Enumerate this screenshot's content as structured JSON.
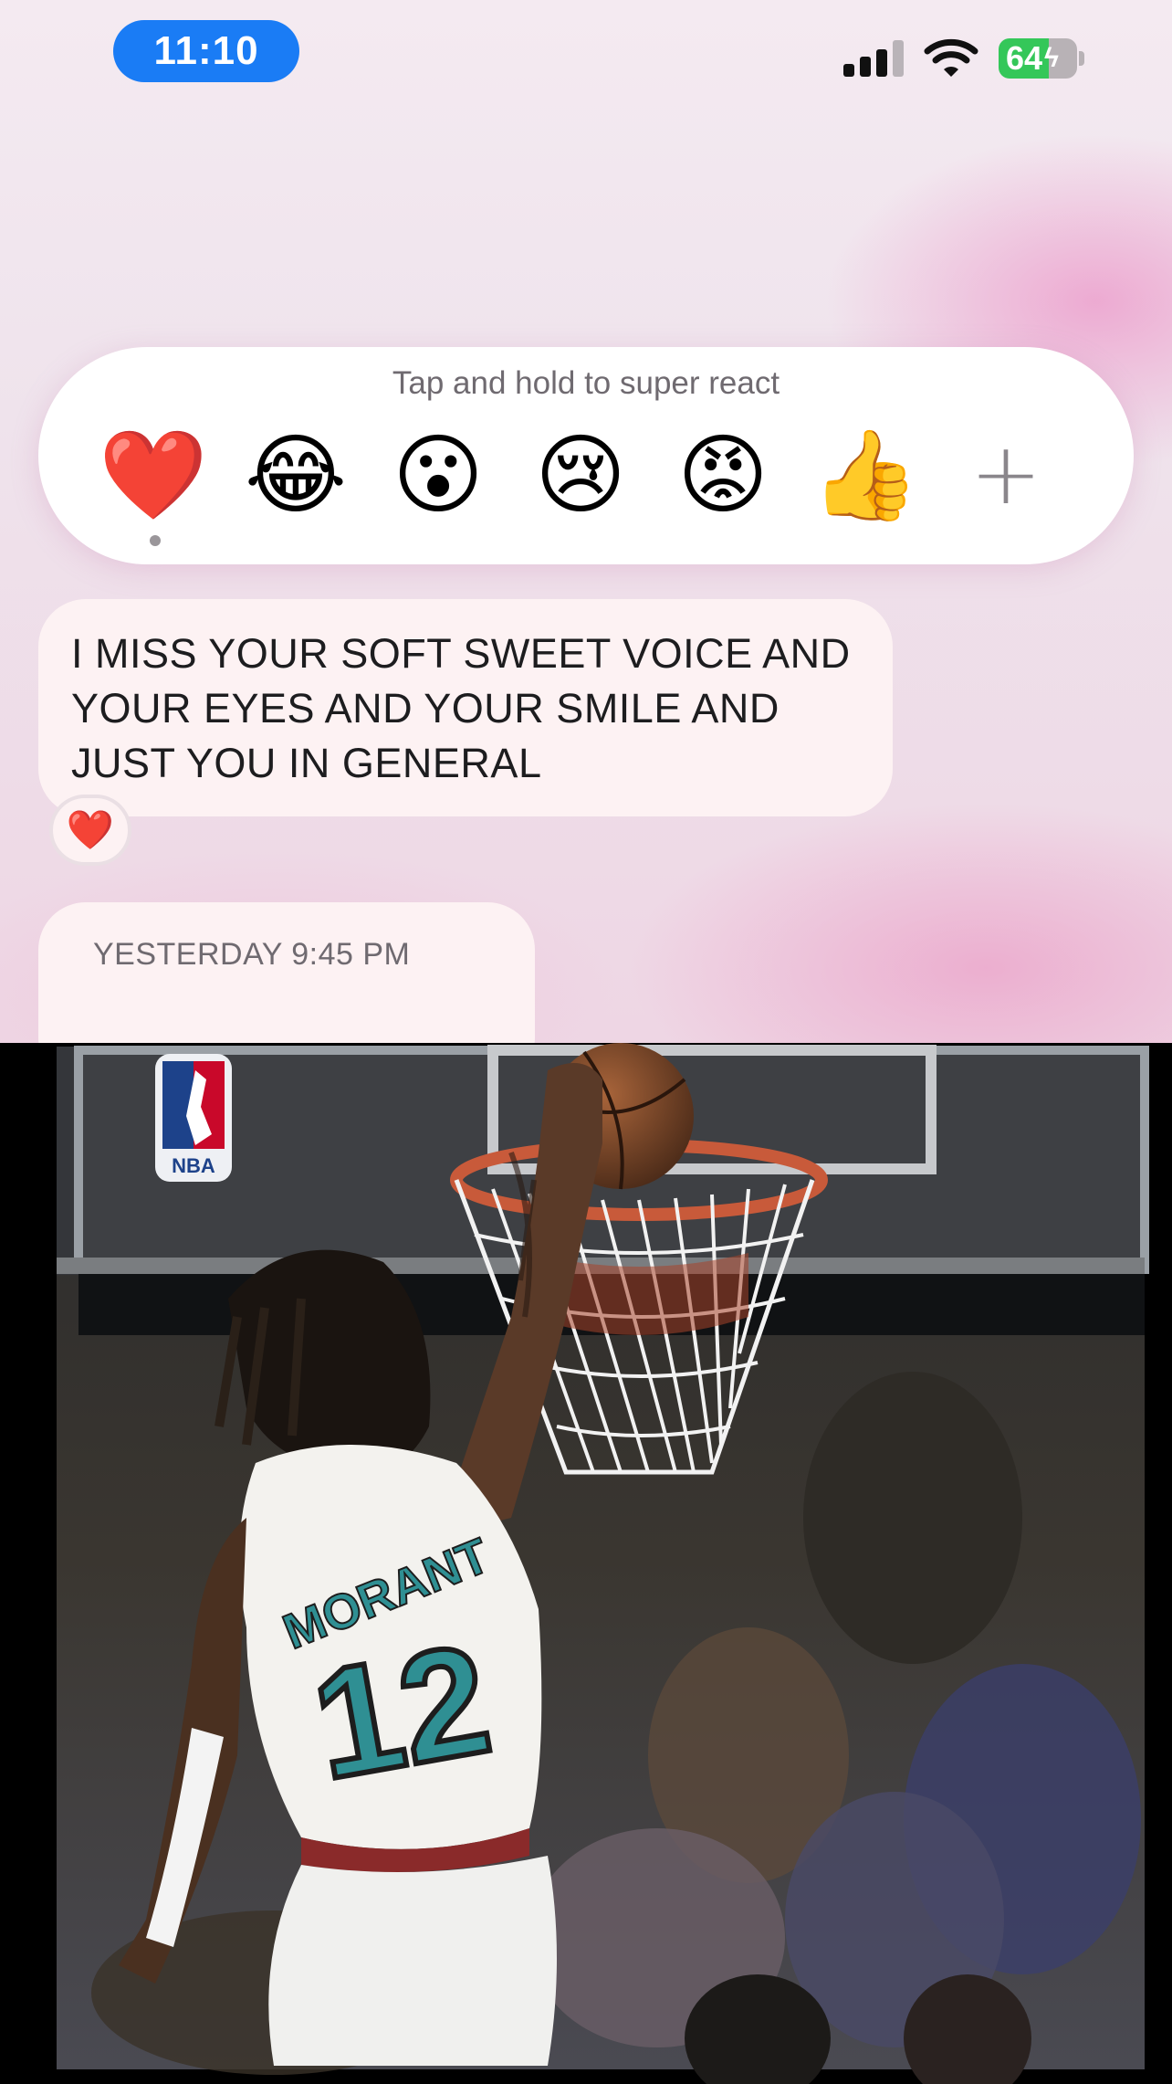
{
  "status_bar": {
    "time": "11:10",
    "battery_level": "64",
    "signal_bars_active": 3,
    "signal_bars_total": 4
  },
  "reaction_bar": {
    "hint": "Tap and hold to super react",
    "emojis": [
      {
        "name": "heart",
        "glyph": "❤️"
      },
      {
        "name": "laughing",
        "glyph": "😂"
      },
      {
        "name": "surprised",
        "glyph": "😮"
      },
      {
        "name": "crying",
        "glyph": "😢"
      },
      {
        "name": "angry",
        "glyph": "😡"
      },
      {
        "name": "thumbs-up",
        "glyph": "👍"
      },
      {
        "name": "add",
        "glyph": "+"
      }
    ],
    "selected": "heart"
  },
  "message": {
    "lines": [
      "I MISS YOUR SOFT SWEET VOICE AND",
      "YOUR EYES AND YOUR SMILE AND",
      "JUST YOU IN GENERAL"
    ],
    "reaction": "❤️"
  },
  "date_header": "YESTERDAY 9:45 PM",
  "photo": {
    "jersey_name": "MORANT",
    "jersey_number": "12",
    "logo_text": "NBA"
  },
  "colors": {
    "time_pill": "#1a7cf5",
    "battery_green": "#34c759",
    "bubble": "#fdf2f3",
    "jersey_teal": "#2f8f93"
  }
}
